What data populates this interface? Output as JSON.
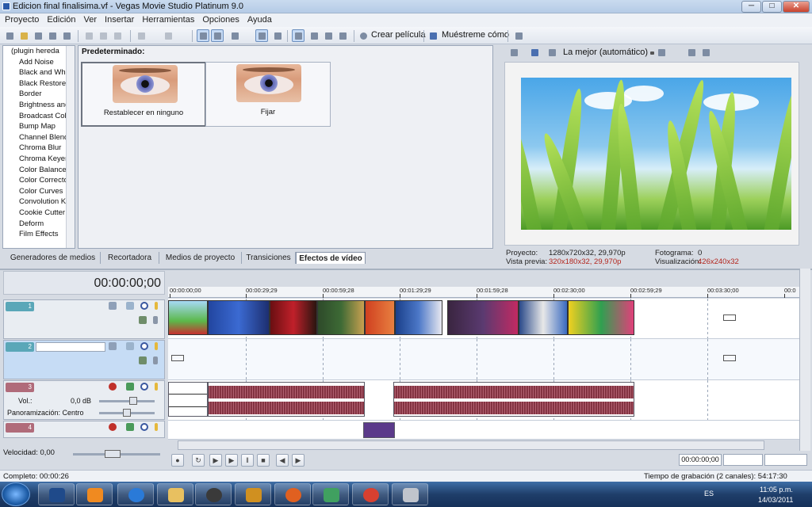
{
  "window": {
    "title": "Edicion final finalisima.vf - Vegas Movie Studio Platinum 9.0",
    "min": "─",
    "max": "□",
    "close": "✕"
  },
  "menu": [
    "Proyecto",
    "Edición",
    "Ver",
    "Insertar",
    "Herramientas",
    "Opciones",
    "Ayuda"
  ],
  "toolbar": {
    "make_movie": "Crear película",
    "show_me_how": "Muéstreme cómo"
  },
  "fx_list": [
    "(plugin hereda",
    "Add Noise",
    "Black and Whit",
    "Black Restore",
    "Border",
    "Brightness and",
    "Broadcast Colo",
    "Bump Map",
    "Channel Blend",
    "Chroma Blur",
    "Chroma Keyer",
    "Color Balance",
    "Color Correcto",
    "Color Curves",
    "Convolution Ke",
    "Cookie Cutter",
    "Deform",
    "Film Effects"
  ],
  "presets": {
    "header": "Predeterminado:",
    "items": [
      "Restablecer en ninguno",
      "Fijar"
    ]
  },
  "tabs": [
    "Generadores de medios",
    "Recortadora",
    "Medios de proyecto",
    "Transiciones",
    "Efectos de vídeo"
  ],
  "preview": {
    "quality": "La mejor (automático)",
    "project_label": "Proyecto:",
    "project_value": "1280x720x32, 29,970p",
    "preview_label": "Vista previa:",
    "preview_value": "320x180x32, 29,970p",
    "frame_label": "Fotograma:",
    "frame_value": "0",
    "display_label": "Visualización:",
    "display_value": "426x240x32"
  },
  "timeline": {
    "timecode": "00:00:00;00",
    "ruler": [
      "00:00:00;00",
      "00:00:29;29",
      "00:00:59;28",
      "00:01:29;29",
      "00:01:59;28",
      "00:02:30;00",
      "00:02:59;29",
      "00:03:30;00",
      "00:0"
    ],
    "tracks": [
      {
        "no": "1",
        "kind": "video"
      },
      {
        "no": "2",
        "kind": "video"
      },
      {
        "no": "3",
        "kind": "audio",
        "vol_label": "Vol.:",
        "vol_value": "0,0 dB",
        "pan_label": "Panoramización: Centro"
      },
      {
        "no": "4",
        "kind": "audio"
      }
    ],
    "end_timecode": "00:00:00;00"
  },
  "rate": "Velocidad: 0,00",
  "status": {
    "left": "Completo: 00:00:26",
    "right": "Tiempo de grabación (2 canales): 54:17:30"
  },
  "taskbar": {
    "lang": "ES",
    "time": "11:05 p.m.",
    "date": "14/03/2011"
  },
  "colors": {
    "audio_wave": "#8a3846",
    "track_video": "#5aa7b8",
    "track_audio": "#b06b7a",
    "selected_track": "#c6dcf5"
  }
}
